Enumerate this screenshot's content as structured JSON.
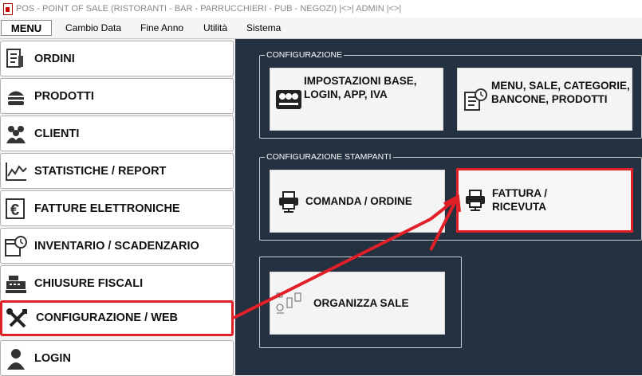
{
  "window": {
    "title": "POS - POINT OF SALE (RISTORANTI - BAR - PARRUCCHIERI - PUB - NEGOZI)   |<>| ADMIN |<>|"
  },
  "menubar": {
    "menu_label": "MENU",
    "items": [
      "Cambio Data",
      "Fine Anno",
      "Utilità",
      "Sistema"
    ]
  },
  "sidebar": {
    "items": [
      {
        "label": "ORDINI",
        "icon": "receipt-icon"
      },
      {
        "label": "PRODOTTI",
        "icon": "burger-icon"
      },
      {
        "label": "CLIENTI",
        "icon": "people-icon"
      },
      {
        "label": "STATISTICHE / REPORT",
        "icon": "chart-icon"
      },
      {
        "label": "FATTURE ELETTRONICHE",
        "icon": "euro-icon"
      },
      {
        "label": "INVENTARIO / SCADENZARIO",
        "icon": "calendar-clock-icon"
      },
      {
        "label": "CHIUSURE FISCALI",
        "icon": "cash-register-icon"
      },
      {
        "label": "CONFIGURAZIONE / WEB",
        "icon": "tools-icon"
      },
      {
        "label": "LOGIN",
        "icon": "user-icon"
      }
    ],
    "active": "CONFIGURAZIONE / WEB"
  },
  "main": {
    "config_group": {
      "title": "CONFIGURAZIONE",
      "tiles": [
        {
          "label": "IMPOSTAZIONI BASE, LOGIN, APP, IVA",
          "icon": "control-panel-icon"
        },
        {
          "label": "MENU, SALE, CATEGORIE, BANCONE, PRODOTTI",
          "icon": "document-clock-icon"
        }
      ]
    },
    "printers_group": {
      "title": "CONFIGURAZIONE STAMPANTI",
      "tiles": [
        {
          "label": "COMANDA / ORDINE",
          "icon": "printer-icon"
        },
        {
          "label": "FATTURA / RICEVUTA",
          "icon": "printer-icon"
        }
      ]
    },
    "rooms_group": {
      "tiles": [
        {
          "label": "ORGANIZZA SALE",
          "icon": "room-layout-icon"
        }
      ]
    }
  },
  "colors": {
    "panel_bg": "#243140",
    "highlight": "#e01f26"
  }
}
